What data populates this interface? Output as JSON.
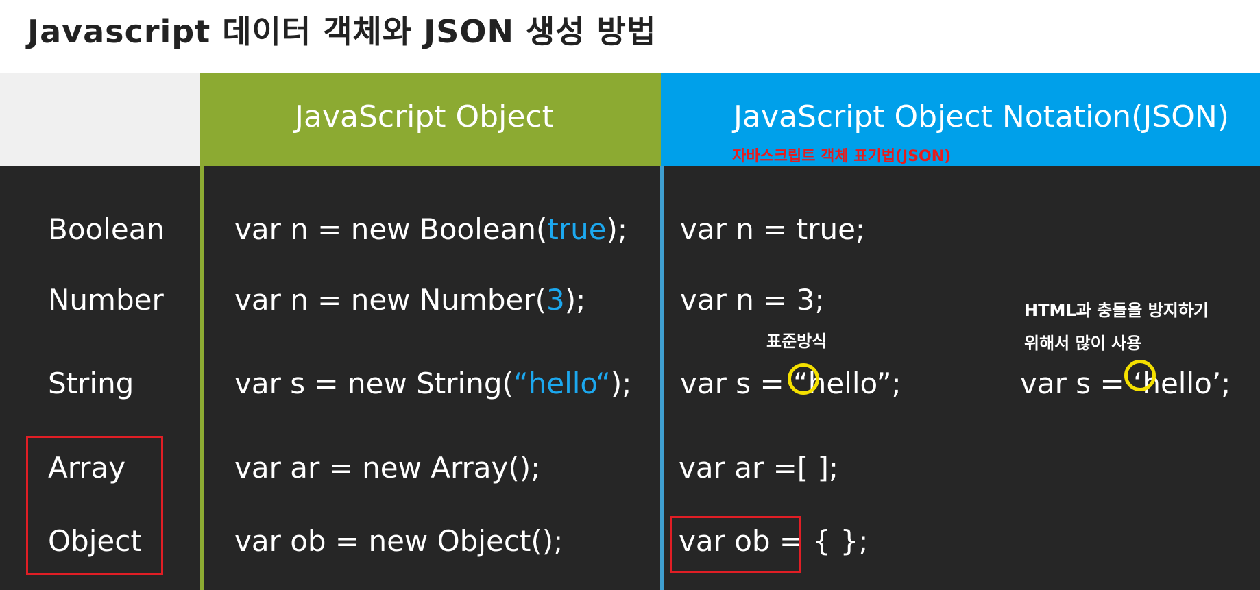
{
  "title": "Javascript 데이터 객체와 JSON 생성 방법",
  "headers": {
    "js_object": "JavaScript Object",
    "json": "JavaScript Object Notation(JSON)",
    "json_sub": "자바스크립트 객체 표기법(JSON)"
  },
  "rows": [
    {
      "type": "Boolean",
      "js_pre": "var n = new Boolean(",
      "js_val": "true",
      "js_post": ");",
      "json": "var n = true;"
    },
    {
      "type": "Number",
      "js_pre": "var n = new Number(",
      "js_val": "3",
      "js_post": ");",
      "json": "var n = 3;"
    },
    {
      "type": "String",
      "js_pre": "var s = new String(",
      "js_val": "“hello“",
      "js_post": ");",
      "json": "var s = “hello”;"
    },
    {
      "type": "Array",
      "js": "var ar = new Array();",
      "json": "var ar =[ ];"
    },
    {
      "type": "Object",
      "js": "var ob = new Object();",
      "json": "var ob = { };"
    }
  ],
  "alt_string": "var s = ‘hello’;",
  "notes": {
    "standard": "표준방식",
    "html_line1": "HTML과 충돌을 방지하기",
    "html_line2": "위해서 많이 사용"
  },
  "colors": {
    "green_header": "#8caa32",
    "blue_header": "#00a0ea",
    "highlight_blue": "#1ca8ef",
    "annotation_red": "#e01e25",
    "circle_yellow": "#f4e000"
  }
}
